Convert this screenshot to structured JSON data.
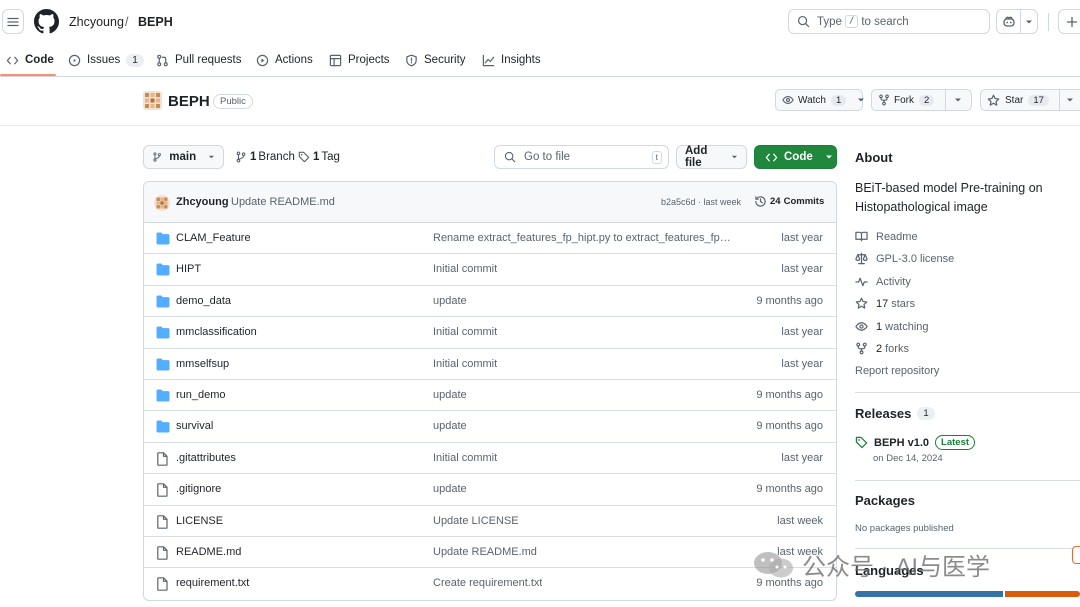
{
  "header": {
    "owner": "Zhcyoung",
    "separator": "/",
    "repo": "BEPH",
    "search_prefix": "Type",
    "search_key": "/",
    "search_suffix": "to search"
  },
  "tabs": [
    {
      "label": "Code",
      "icon": "code-icon",
      "active": true
    },
    {
      "label": "Issues",
      "icon": "issue-icon",
      "count": "1"
    },
    {
      "label": "Pull requests",
      "icon": "pull-request-icon"
    },
    {
      "label": "Actions",
      "icon": "play-icon"
    },
    {
      "label": "Projects",
      "icon": "table-icon"
    },
    {
      "label": "Security",
      "icon": "shield-icon"
    },
    {
      "label": "Insights",
      "icon": "graph-icon"
    }
  ],
  "repo": {
    "name": "BEPH",
    "visibility": "Public",
    "watch_label": "Watch",
    "watch_count": "1",
    "fork_label": "Fork",
    "fork_count": "2",
    "star_label": "Star",
    "star_count": "17"
  },
  "toolbar": {
    "branch": "main",
    "branches_count": "1",
    "branches_label": "Branch",
    "tags_count": "1",
    "tags_label": "Tag",
    "goto_placeholder": "Go to file",
    "goto_key": "t",
    "add_file": "Add file",
    "code_button": "Code"
  },
  "commit": {
    "author": "Zhcyoung",
    "message": "Update README.md",
    "hash_time": "b2a5c6d · last week",
    "commits_count": "24",
    "commits_label": "Commits"
  },
  "files": [
    {
      "type": "dir",
      "name": "CLAM_Feature",
      "message": "Rename extract_features_fp_hipt.py to extract_features_fp_DI...",
      "date": "last year"
    },
    {
      "type": "dir",
      "name": "HIPT",
      "message": "Initial commit",
      "date": "last year"
    },
    {
      "type": "dir",
      "name": "demo_data",
      "message": "update",
      "date": "9 months ago"
    },
    {
      "type": "dir",
      "name": "mmclassification",
      "message": "Initial commit",
      "date": "last year"
    },
    {
      "type": "dir",
      "name": "mmselfsup",
      "message": "Initial commit",
      "date": "last year"
    },
    {
      "type": "dir",
      "name": "run_demo",
      "message": "update",
      "date": "9 months ago"
    },
    {
      "type": "dir",
      "name": "survival",
      "message": "update",
      "date": "9 months ago"
    },
    {
      "type": "file",
      "name": ".gitattributes",
      "message": "Initial commit",
      "date": "last year"
    },
    {
      "type": "file",
      "name": ".gitignore",
      "message": "update",
      "date": "9 months ago"
    },
    {
      "type": "file",
      "name": "LICENSE",
      "message": "Update LICENSE",
      "date": "last week"
    },
    {
      "type": "file",
      "name": "README.md",
      "message": "Update README.md",
      "date": "last week"
    },
    {
      "type": "file",
      "name": "requirement.txt",
      "message": "Create requirement.txt",
      "date": "9 months ago"
    }
  ],
  "about": {
    "heading": "About",
    "description": "BEiT-based model Pre-training on Histopathological image",
    "readme": "Readme",
    "license": "GPL-3.0 license",
    "activity": "Activity",
    "stars_count": "17",
    "stars_label": "stars",
    "watching_count": "1",
    "watching_label": "watching",
    "forks_count": "2",
    "forks_label": "forks",
    "report": "Report repository"
  },
  "releases": {
    "heading": "Releases",
    "count": "1",
    "name": "BEPH v1.0",
    "badge": "Latest",
    "date": "on Dec 14, 2024"
  },
  "packages": {
    "heading": "Packages",
    "text": "No packages published"
  },
  "languages": {
    "heading": "Languages",
    "bar_colors": [
      "#3572A5",
      "#DA5B0B"
    ]
  },
  "watermark": {
    "text": "公众号 · AI与医学"
  },
  "colors": {
    "accent_green": "#1f883d",
    "folder_blue": "#54aeff",
    "tab_underline": "#fd8c73"
  }
}
